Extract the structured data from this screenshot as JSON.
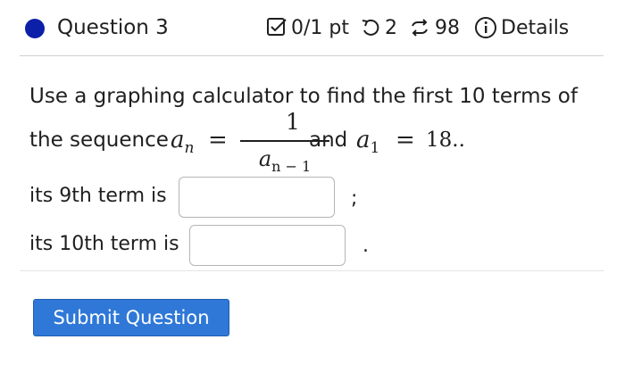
{
  "header": {
    "question_title": "Question 3",
    "score": "0/1 pt",
    "retries": "2",
    "attempts": "98",
    "details_label": "Details"
  },
  "problem": {
    "intro": "Use a graphing calculator to find the first 10 terms of",
    "sequence_label": "the sequence",
    "and_label": "and",
    "seq_var": "a",
    "seq_sub": "n",
    "fraction_numerator": "1",
    "fraction_den_var": "a",
    "fraction_den_sub": "n − 1",
    "init_var": "a",
    "init_sub": "1",
    "equals": "=",
    "initial_value": "18.."
  },
  "answers": {
    "ninth_label": "its 9th term is",
    "ninth_value": "",
    "ninth_punct": ";",
    "tenth_label": "its 10th term is",
    "tenth_value": "",
    "tenth_punct": "."
  },
  "actions": {
    "submit_label": "Submit Question"
  },
  "colors": {
    "question_dot": "#0b1fa8",
    "submit_bg": "#2f78d8"
  }
}
